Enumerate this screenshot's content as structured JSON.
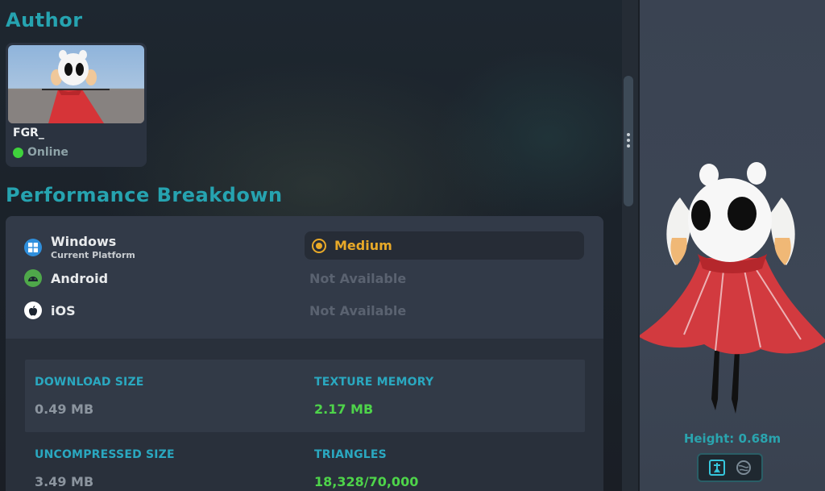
{
  "author": {
    "section_title": "Author",
    "name": "FGR_",
    "status": "Online",
    "status_color": "#3fd23c"
  },
  "performance": {
    "section_title": "Performance Breakdown",
    "platforms": [
      {
        "name": "Windows",
        "subtitle": "Current Platform",
        "rating": "Medium",
        "icon": "windows-icon",
        "icon_color": "#2f8fdd"
      },
      {
        "name": "Android",
        "rating": "Not Available",
        "icon": "android-icon",
        "icon_color": "#4fa84a"
      },
      {
        "name": "iOS",
        "rating": "Not Available",
        "icon": "apple-icon",
        "icon_color": "#ffffff"
      }
    ],
    "rating_color": "#e8a928"
  },
  "stats": {
    "download_size_label": "DOWNLOAD SIZE",
    "download_size": "0.49 MB",
    "texture_memory_label": "TEXTURE MEMORY",
    "texture_memory": "2.17 MB",
    "uncompressed_size_label": "UNCOMPRESSED SIZE",
    "uncompressed_size": "3.49 MB",
    "triangles_label": "TRIANGLES",
    "triangles": "18,328/70,000"
  },
  "preview": {
    "height_text": "Height: 0.68m",
    "view_buttons": [
      "rig-icon",
      "sphere-icon"
    ]
  },
  "colors": {
    "accent": "#26a3b0",
    "good": "#4ed44a"
  }
}
